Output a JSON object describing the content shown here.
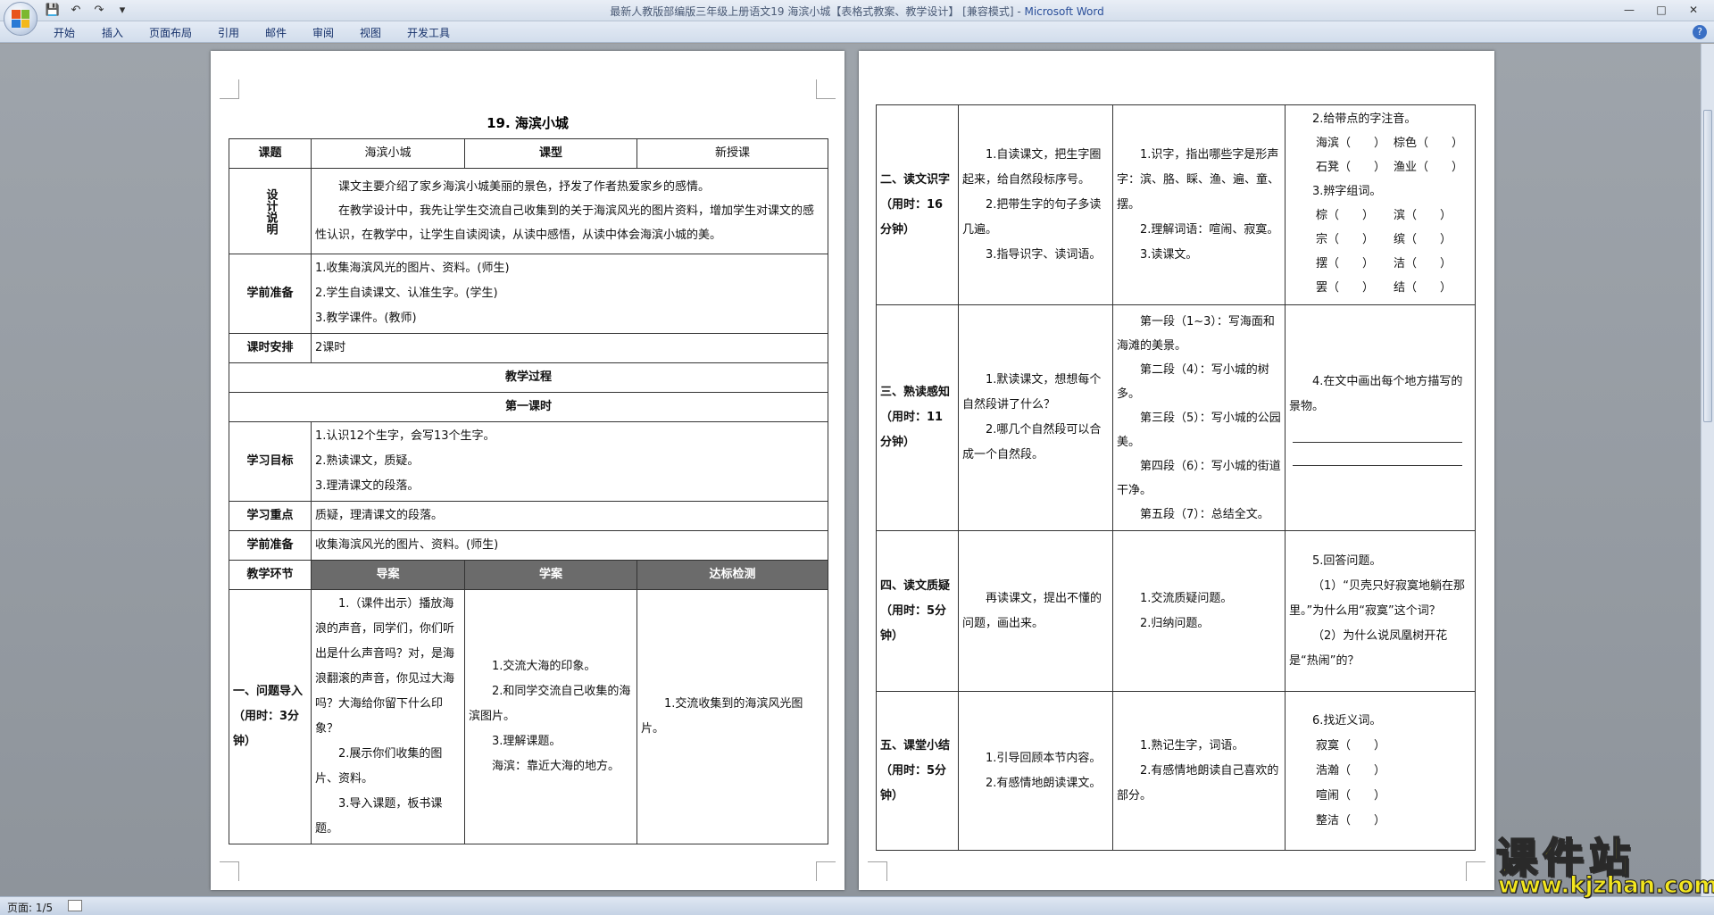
{
  "window": {
    "title": "最新人教版部编版三年级上册语文19 海滨小城【表格式教案、教学设计】 [兼容模式]",
    "app_name": "Microsoft Word",
    "controls": [
      "—",
      "□",
      "✕"
    ]
  },
  "quick_access": [
    "💾",
    "↶",
    "↷",
    "▾"
  ],
  "ribbon": {
    "tabs": [
      "开始",
      "插入",
      "页面布局",
      "引用",
      "邮件",
      "审阅",
      "视图",
      "开发工具"
    ],
    "help": "?"
  },
  "status": {
    "page": "页面: 1/5"
  },
  "watermark": {
    "main": "课件站",
    "url": "www.kjzhan.com"
  },
  "page1": {
    "title": "19. 海滨小城",
    "topic_label": "课题",
    "topic_value": "海滨小城",
    "type_label": "课型",
    "type_value": "新授课",
    "design_label": "设计说明",
    "design_p1": "课文主要介绍了家乡海滨小城美丽的景色，抒发了作者热爱家乡的感情。",
    "design_p2": "在教学设计中，我先让学生交流自己收集到的关于海滨风光的图片资料，增加学生对课文的感性认识，在教学中，让学生自读阅读，从读中感悟，从读中体会海滨小城的美。",
    "prep_label": "学前准备",
    "prep_items": [
      "1.收集海滨风光的图片、资料。(师生)",
      "2.学生自读课文、认准生字。(学生)",
      "3.教学课件。(教师)"
    ],
    "hours_label": "课时安排",
    "hours_value": "2课时",
    "process_title": "教学过程",
    "lesson_title": "第一课时",
    "goal_label": "学习目标",
    "goal_items": [
      "1.认识12个生字，会写13个生字。",
      "2.熟读课文，质疑。",
      "3.理清课文的段落。"
    ],
    "key_label": "学习重点",
    "key_value": "质疑，理清课文的段落。",
    "prep2_label": "学前准备",
    "prep2_value": "收集海滨风光的图片、资料。(师生)",
    "step_label": "教学环节",
    "col_guide": "导案",
    "col_study": "学案",
    "col_check": "达标检测",
    "sec1_label": "一、问题导入（用时：3分钟）",
    "sec1_guide": [
      "1.（课件出示）播放海浪的声音，同学们，你们听出是什么声音吗？对，是海浪翻滚的声音，你见过大海吗？大海给你留下什么印象？",
      "2.展示你们收集的图片、资料。",
      "3.导入课题，板书课题。"
    ],
    "sec1_study": [
      "1.交流大海的印象。",
      "2.和同学交流自己收集的海滨图片。",
      "3.理解课题。",
      "海滨：靠近大海的地方。"
    ],
    "sec1_check": "1.交流收集到的海滨风光图片。"
  },
  "page2": {
    "sec2_label": "二、读文识字（用时：16分钟）",
    "sec2_guide": [
      "1.自读课文，把生字圈起来，给自然段标序号。",
      "2.把带生字的句子多读几遍。",
      "3.指导识字、读词语。"
    ],
    "sec2_study": [
      "1.识字，指出哪些字是形声字：滨、胳、睬、渔、遍、童、摆。",
      "2.理解词语：喧闹、寂寞。",
      "3.读课文。"
    ],
    "sec2_check_title1": "2.给带点的字注音。",
    "sec2_pinyin": [
      "海滨（　　）",
      "棕色（　　）",
      "石凳（　　）",
      "渔业（　　）"
    ],
    "sec2_check_title2": "3.辨字组词。",
    "sec2_words": [
      "棕（　　）",
      "滨（　　）",
      "宗（　　）",
      "缤（　　）",
      "摆（　　）",
      "洁（　　）",
      "罢（　　）",
      "结（　　）"
    ],
    "sec3_label": "三、熟读感知（用时：11分钟）",
    "sec3_guide": [
      "1.默读课文，想想每个自然段讲了什么？",
      "2.哪几个自然段可以合成一个自然段。"
    ],
    "sec3_study": [
      "第一段（1~3）：写海面和海滩的美景。",
      "第二段（4）：写小城的树多。",
      "第三段（5）：写小城的公园美。",
      "第四段（6）：写小城的街道干净。",
      "第五段（7）：总结全文。"
    ],
    "sec3_check": "4.在文中画出每个地方描写的景物。",
    "sec4_label": "四、读文质疑（用时：5分钟）",
    "sec4_guide": "再读课文，提出不懂的问题，画出来。",
    "sec4_study": [
      "1.交流质疑问题。",
      "2.归纳问题。"
    ],
    "sec4_check": [
      "5.回答问题。",
      "（1）“贝壳只好寂寞地躺在那里。”为什么用“寂寞”这个词？",
      "（2）为什么说凤凰树开花是“热闹”的？"
    ],
    "sec5_label": "五、课堂小结（用时：5分钟）",
    "sec5_guide": [
      "1.引导回顾本节内容。",
      "2.有感情地朗读课文。"
    ],
    "sec5_study": [
      "1.熟记生字，词语。",
      "2.有感情地朗读自己喜欢的部分。"
    ],
    "sec5_check_title": "6.找近义词。",
    "sec5_synonyms": [
      "寂寞（　　）",
      "浩瀚（　　）",
      "喧闹（　　）",
      "整洁（　　）"
    ]
  }
}
